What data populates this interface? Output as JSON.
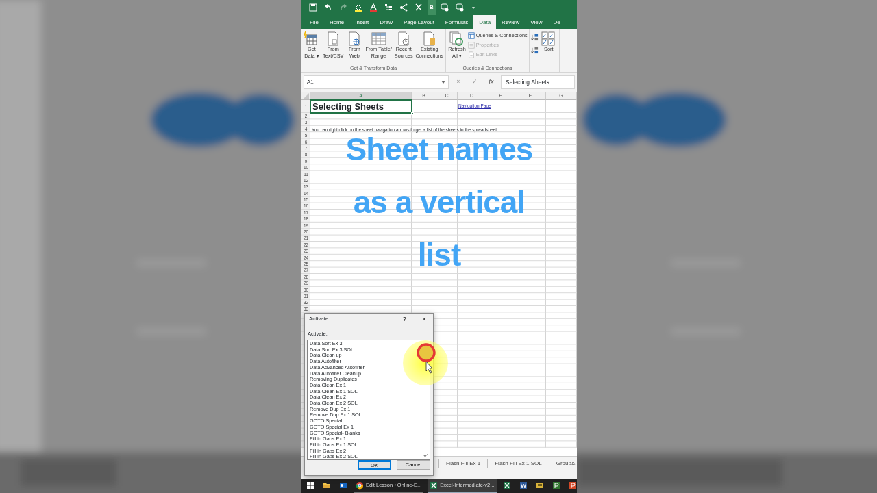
{
  "quick_access_toolbar": [
    {
      "kind": "save"
    },
    {
      "kind": "undo"
    },
    {
      "kind": "redo",
      "disabled": true
    },
    {
      "kind": "fill"
    },
    {
      "kind": "font-color"
    },
    {
      "kind": "tree"
    },
    {
      "kind": "share"
    },
    {
      "kind": "scissors"
    },
    {
      "kind": "bold",
      "label": "B",
      "on": true
    },
    {
      "kind": "shape"
    },
    {
      "kind": "shape"
    },
    {
      "kind": "more"
    }
  ],
  "ribbon_tabs": [
    {
      "label": "File",
      "selected": false
    },
    {
      "label": "Home",
      "selected": false
    },
    {
      "label": "Insert",
      "selected": false
    },
    {
      "label": "Draw",
      "selected": false
    },
    {
      "label": "Page Layout",
      "selected": false
    },
    {
      "label": "Formulas",
      "selected": false
    },
    {
      "label": "Data",
      "selected": true
    },
    {
      "label": "Review",
      "selected": false
    },
    {
      "label": "View",
      "selected": false
    },
    {
      "label": "De",
      "selected": false
    }
  ],
  "ribbon_groups": [
    {
      "label": "Get & Transform Data",
      "buttons": [
        {
          "kind": "get-data",
          "lines": [
            "Get",
            "Data ▾"
          ]
        },
        {
          "kind": "document",
          "lines": [
            "From",
            "Text/CSV"
          ]
        },
        {
          "kind": "web",
          "lines": [
            "From",
            "Web"
          ]
        },
        {
          "kind": "table",
          "lines": [
            "From Table/",
            "Range"
          ]
        },
        {
          "kind": "recent",
          "lines": [
            "Recent",
            "Sources"
          ]
        },
        {
          "kind": "connections",
          "lines": [
            "Existing",
            "Connections"
          ]
        }
      ]
    },
    {
      "label": "Queries & Connections",
      "buttons": [
        {
          "kind": "refresh",
          "lines": [
            "Refresh",
            "All ▾"
          ]
        }
      ],
      "small_buttons": [
        {
          "kind": "queries",
          "label": "Queries & Connections",
          "disabled": false
        },
        {
          "kind": "properties",
          "label": "Properties",
          "disabled": true
        },
        {
          "kind": "links",
          "label": "Edit Links",
          "disabled": true
        }
      ]
    },
    {
      "buttons": [
        {
          "kind": "sort",
          "lines": [
            "Sort"
          ]
        }
      ]
    }
  ],
  "formula_bar": {
    "name_box": "A1",
    "cancel": "×",
    "enter": "✓",
    "function_label": "fx",
    "value": "Selecting Sheets"
  },
  "sheet": {
    "columns": [
      {
        "label": "A",
        "selected": true
      },
      {
        "label": "B",
        "selected": false
      },
      {
        "label": "C",
        "selected": false
      },
      {
        "label": "D",
        "selected": false
      },
      {
        "label": "E",
        "selected": false
      },
      {
        "label": "F",
        "selected": false
      },
      {
        "label": "G",
        "selected": false
      }
    ],
    "rows": [
      {
        "header": "1",
        "cells": {
          "A": {
            "kind": "title",
            "text": "Selecting Sheets",
            "selected": true
          },
          "D": {
            "kind": "link",
            "text": "Navigation Page",
            "selected": false
          }
        }
      },
      {
        "header": "2"
      },
      {
        "header": "3"
      },
      {
        "header": "4",
        "cells": {
          "A": {
            "kind": "note",
            "text": "You can right click on the sheet navigation arrows to get a list of the sheets in the spreadsheet",
            "selected": false
          }
        }
      },
      {
        "header": "5"
      },
      {
        "header": "6"
      },
      {
        "header": "7"
      },
      {
        "header": "8"
      },
      {
        "header": "9"
      },
      {
        "header": "10"
      },
      {
        "header": "11"
      },
      {
        "header": "12"
      },
      {
        "header": "13"
      },
      {
        "header": "14"
      },
      {
        "header": "15"
      },
      {
        "header": "16"
      },
      {
        "header": "17"
      },
      {
        "header": "18"
      },
      {
        "header": "19"
      },
      {
        "header": "20"
      },
      {
        "header": "21"
      },
      {
        "header": "22"
      },
      {
        "header": "23"
      },
      {
        "header": "24"
      },
      {
        "header": "25"
      },
      {
        "header": "27"
      },
      {
        "header": "28"
      },
      {
        "header": "29"
      },
      {
        "header": "30"
      },
      {
        "header": "31"
      },
      {
        "header": "32"
      },
      {
        "header": "33"
      }
    ]
  },
  "overlay_caption": [
    "Sheet names",
    "as a vertical",
    "list"
  ],
  "activate_dialog": {
    "title": "Activate",
    "help": "?",
    "close": "×",
    "list_label": "Activate:",
    "items": [
      "Data Sort Ex 3",
      "Data Sort Ex 3 SOL",
      "Data Clean up",
      "Data Autofilter",
      "Data Advanced Autofilter",
      "Data Autofilter Cleanup",
      "Removing Duplicates",
      "Data Clean Ex 1",
      "Data Clean Ex 1 SOL",
      "Data Clean Ex 2",
      "Data Clean Ex 2 SOL",
      "Remove Dup Ex 1",
      "Remove Dup Ex 1 SOL",
      "GOTO Special",
      "GOTO Special Ex 1",
      "GOTO Special- Blanks",
      "Fill in Gaps Ex 1",
      "Fill in Gaps Ex 1 SOL",
      "Fill in Gaps Ex 2",
      "Fill in Gaps Ex 2 SOL"
    ],
    "buttons": [
      {
        "label": "OK",
        "default": true
      },
      {
        "label": "Cancel",
        "default": false
      }
    ]
  },
  "sheet_tabs": [
    {
      "label": "Flash Fill Ex 1",
      "selected": false
    },
    {
      "label": "Flash Fill Ex 1 SOL",
      "selected": false
    },
    {
      "label": "Group&",
      "selected": false
    }
  ],
  "taskbar": [
    {
      "kind": "start"
    },
    {
      "kind": "folder"
    },
    {
      "kind": "outlook"
    },
    {
      "kind": "chrome",
      "label": "Edit Lesson ‹ Online-E...",
      "active": false
    },
    {
      "kind": "excel",
      "label": "Excel-Intermediate-v2...",
      "active": true
    },
    {
      "kind": "excel"
    },
    {
      "kind": "word"
    },
    {
      "kind": "yellow-app"
    },
    {
      "kind": "project"
    },
    {
      "kind": "powerpoint"
    }
  ]
}
